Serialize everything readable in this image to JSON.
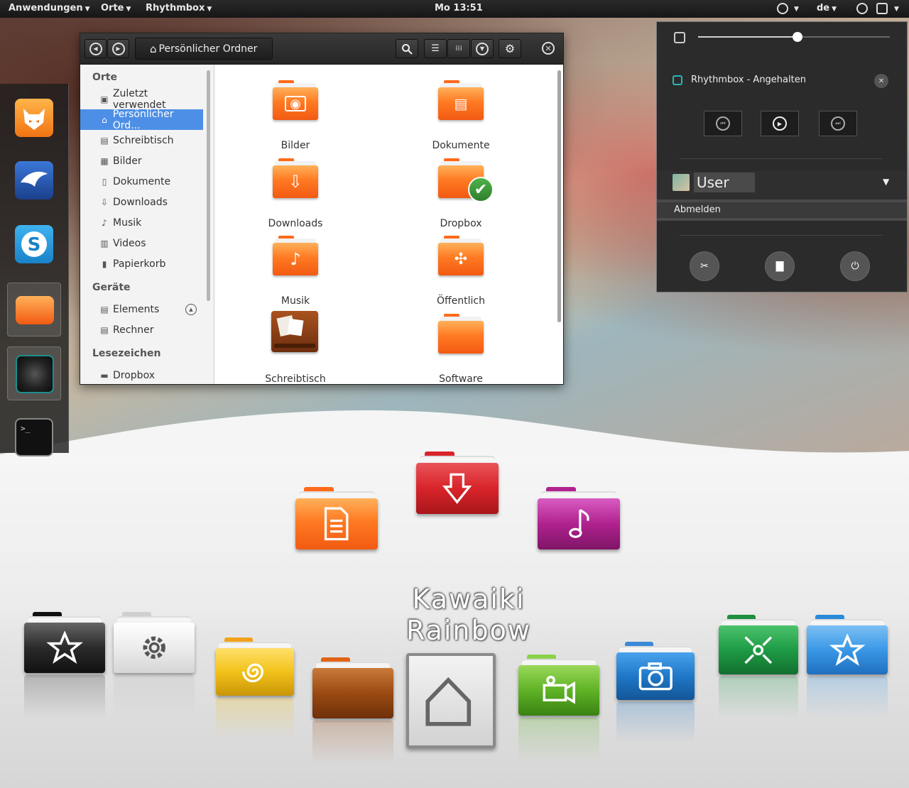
{
  "top_panel": {
    "applications": "Anwendungen",
    "places": "Orte",
    "app": "Rhythmbox",
    "clock": "Mo 13:51",
    "keyboard_layout": "de"
  },
  "file_manager": {
    "path_label": "Persönlicher Ordner",
    "sidebar": {
      "places_heading": "Orte",
      "places": [
        {
          "label": "Zuletzt verwendet",
          "icon": "recent-icon"
        },
        {
          "label": "Persönlicher Ord...",
          "icon": "home-icon",
          "selected": true
        },
        {
          "label": "Schreibtisch",
          "icon": "desktop-icon"
        },
        {
          "label": "Bilder",
          "icon": "camera-icon"
        },
        {
          "label": "Dokumente",
          "icon": "document-icon"
        },
        {
          "label": "Downloads",
          "icon": "download-icon"
        },
        {
          "label": "Musik",
          "icon": "music-icon"
        },
        {
          "label": "Videos",
          "icon": "film-icon"
        },
        {
          "label": "Papierkorb",
          "icon": "trash-icon"
        }
      ],
      "devices_heading": "Geräte",
      "devices": [
        {
          "label": "Elements",
          "icon": "drive-icon"
        },
        {
          "label": "Rechner",
          "icon": "computer-icon"
        }
      ],
      "bookmarks_heading": "Lesezeichen",
      "bookmarks": [
        {
          "label": "Dropbox",
          "icon": "folder-icon"
        }
      ]
    },
    "items": [
      {
        "label": "Bilder",
        "icon": "camera-icon"
      },
      {
        "label": "Dokumente",
        "icon": "document-icon"
      },
      {
        "label": "Downloads",
        "icon": "download-icon"
      },
      {
        "label": "Dropbox",
        "icon": "check-icon"
      },
      {
        "label": "Musik",
        "icon": "music-icon"
      },
      {
        "label": "Öffentlich",
        "icon": "share-icon"
      },
      {
        "label": "Schreibtisch",
        "icon": "desktop-icon"
      },
      {
        "label": "Software",
        "icon": "folder-icon"
      }
    ]
  },
  "menu_panel": {
    "volume_level": 0.52,
    "player_title": "Rhythmbox - Angehalten",
    "user_name": "User",
    "logout_label": "Abmelden"
  },
  "showcase": {
    "brand": "Kawaiki Rainbow"
  },
  "colors": {
    "accent_selected": "#4d8fe6",
    "folder_orange": "#ff7a22",
    "folder_red": "#d8242a",
    "folder_purple": "#b0228f",
    "folder_yellow": "#f2c21a",
    "folder_brown": "#9a4a12",
    "folder_green": "#5fb325",
    "folder_blue": "#1f78c8",
    "folder_teal_green": "#1e9b45",
    "folder_sky": "#3a98e6"
  }
}
